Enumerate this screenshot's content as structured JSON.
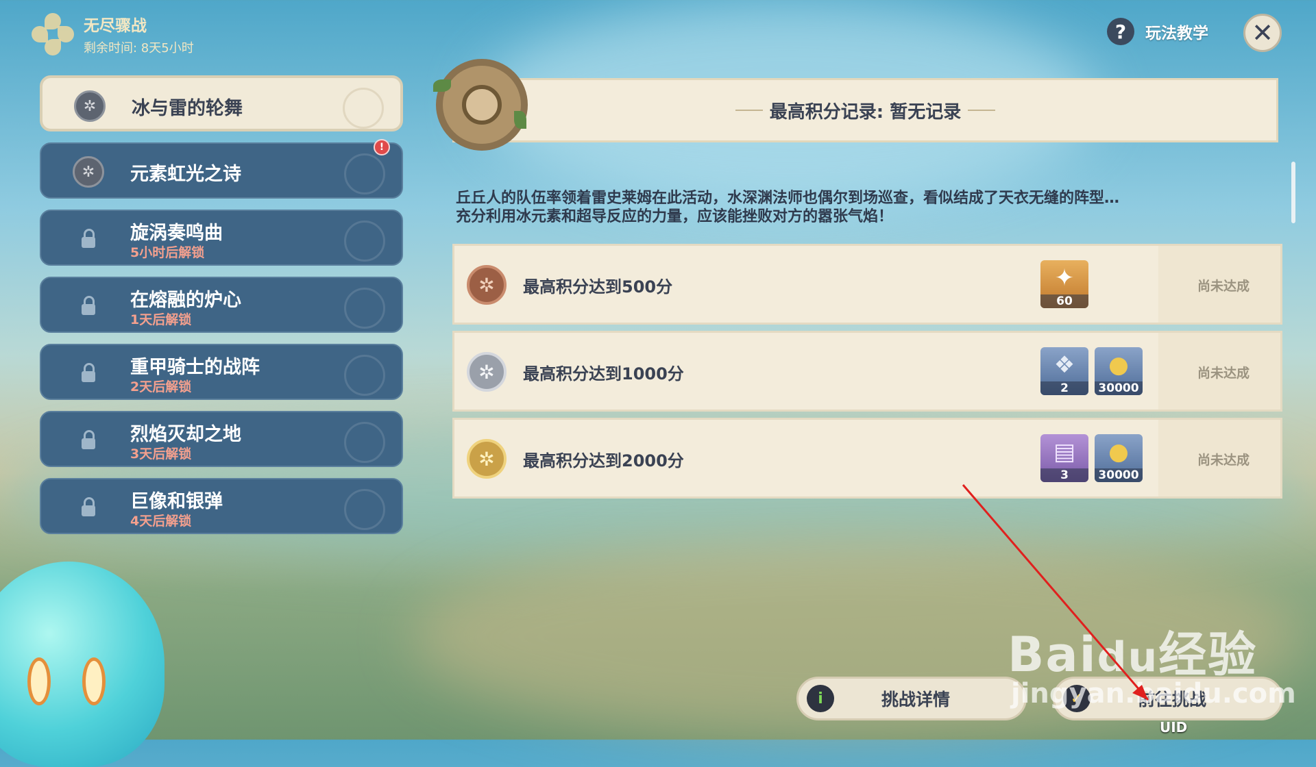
{
  "event": {
    "title": "无尽骤战",
    "remaining": "剩余时间: 8天5小时"
  },
  "top_right": {
    "tutorial_label": "玩法教学",
    "close_symbol": "✕"
  },
  "stages": [
    {
      "name": "冰与雷的轮舞",
      "sub": "",
      "state": "selected"
    },
    {
      "name": "元素虹光之诗",
      "sub": "",
      "state": "unlocked",
      "new_badge": "!"
    },
    {
      "name": "旋涡奏鸣曲",
      "sub": "5小时后解锁",
      "state": "locked"
    },
    {
      "name": "在熔融的炉心",
      "sub": "1天后解锁",
      "state": "locked"
    },
    {
      "name": "重甲骑士的战阵",
      "sub": "2天后解锁",
      "state": "locked"
    },
    {
      "name": "烈焰灭却之地",
      "sub": "3天后解锁",
      "state": "locked"
    },
    {
      "name": "巨像和银弹",
      "sub": "4天后解锁",
      "state": "locked"
    }
  ],
  "score_banner": {
    "text": "最高积分记录: 暂无记录"
  },
  "description": {
    "line1": "丘丘人的队伍率领着雷史莱姆在此活动，水深渊法师也偶尔到场巡查，看似结成了天衣无缝的阵型…",
    "line2": "充分利用冰元素和超导反应的力量，应该能挫败对方的嚣张气焰！"
  },
  "rewards": [
    {
      "label": "最高积分达到500分",
      "medal": "bronze",
      "status": "尚未达成",
      "items": [
        {
          "icon": "primogem-icon",
          "count": "60",
          "style": "orange"
        }
      ]
    },
    {
      "label": "最高积分达到1000分",
      "medal": "silver",
      "status": "尚未达成",
      "items": [
        {
          "icon": "talent-book-icon",
          "count": "2",
          "style": "blue"
        },
        {
          "icon": "mora-icon",
          "count": "30000",
          "style": "blue"
        }
      ]
    },
    {
      "label": "最高积分达到2000分",
      "medal": "gold",
      "status": "尚未达成",
      "items": [
        {
          "icon": "purple-book-icon",
          "count": "3",
          "style": "purple"
        },
        {
          "icon": "mora-icon",
          "count": "30000",
          "style": "blue"
        }
      ]
    }
  ],
  "buttons": {
    "details": "挑战详情",
    "go": "前往挑战"
  },
  "uid": "UID",
  "watermark": "Baidu经验 jingyan.baidu.com"
}
